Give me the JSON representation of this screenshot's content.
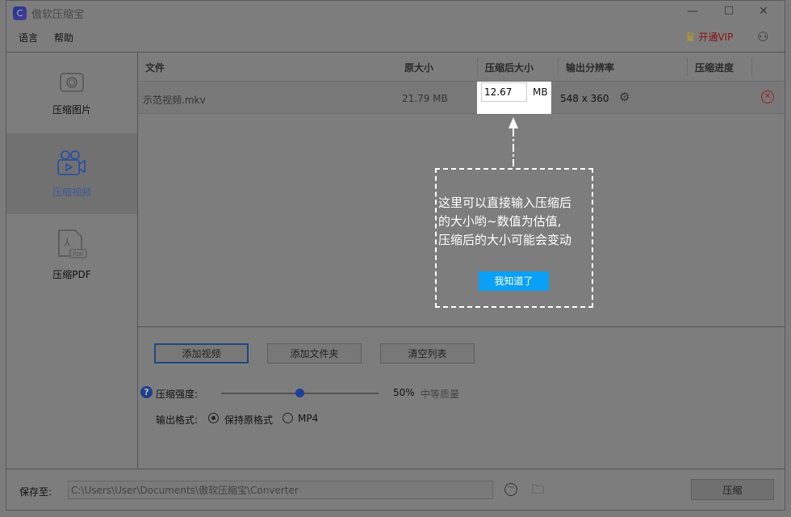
{
  "app": {
    "title": "傲软压缩宝",
    "logo_letter": "C"
  },
  "menu": {
    "language": "语言",
    "help": "帮助",
    "vip": "开通VIP"
  },
  "sidebar": {
    "items": [
      {
        "label": "压缩图片"
      },
      {
        "label": "压缩视频"
      },
      {
        "label": "压缩PDF"
      }
    ]
  },
  "table": {
    "headers": [
      "文件",
      "原大小",
      "压缩后大小",
      "输出分辨率",
      "压缩进度"
    ],
    "rows": [
      {
        "file": "示范视频.mkv",
        "original_size": "21.79 MB",
        "compressed_size": "12.67",
        "unit": "MB",
        "resolution": "548 x 360"
      }
    ]
  },
  "tooltip": {
    "text_lines": [
      "这里可以直接输入压缩后",
      "的大小哟~数值为估值,",
      "压缩后的大小可能会变动"
    ],
    "button": "我知道了"
  },
  "actions": {
    "add_video": "添加视频",
    "add_folder": "添加文件夹",
    "clear_list": "清空列表"
  },
  "strength": {
    "label": "压缩强度:",
    "value_percent": 50,
    "value_text": "50%",
    "quality": "中等质量"
  },
  "format": {
    "label": "输出格式:",
    "options": [
      "保持原格式",
      "MP4"
    ],
    "selected": "保持原格式"
  },
  "save": {
    "label": "保存至:",
    "path": "C:\\Users\\User\\Documents\\傲软压缩宝\\Converter",
    "compress_button": "压缩"
  },
  "colors": {
    "accent": "#3d5a99",
    "tip_button": "#0aa0f5",
    "vip": "#8b1010"
  }
}
